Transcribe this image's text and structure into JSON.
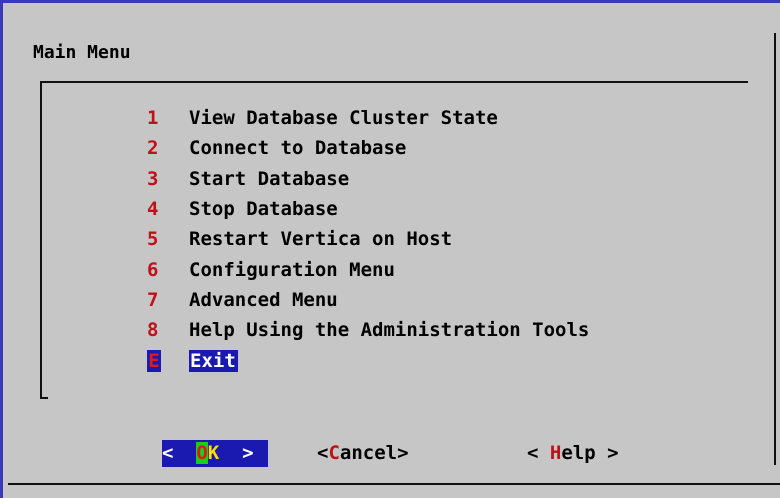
{
  "dialog": {
    "title": "Main Menu"
  },
  "menu": {
    "items": [
      {
        "key": "1",
        "label": "View Database Cluster State"
      },
      {
        "key": "2",
        "label": "Connect to Database"
      },
      {
        "key": "3",
        "label": "Start Database"
      },
      {
        "key": "4",
        "label": "Stop Database"
      },
      {
        "key": "5",
        "label": "Restart Vertica on Host"
      },
      {
        "key": "6",
        "label": "Configuration Menu"
      },
      {
        "key": "7",
        "label": "Advanced Menu"
      },
      {
        "key": "8",
        "label": "Help Using the Administration Tools"
      },
      {
        "key": "E",
        "label": "Exit"
      }
    ],
    "selected_key": "E"
  },
  "buttons": {
    "ok": {
      "left": "<  ",
      "hotkey": "O",
      "rest": "K",
      "right": "  >"
    },
    "cancel": {
      "left": "<",
      "hotkey": "C",
      "rest": "ancel",
      "right": ">"
    },
    "help": {
      "left": "< ",
      "hotkey": "H",
      "rest": "elp",
      "right": " >"
    }
  },
  "colors": {
    "background": "#c6c6c6",
    "selection": "#1a1ab0",
    "hotkey": "#c0101a",
    "ok_highlight": "#18d018",
    "ok_text": "#ffe000"
  }
}
